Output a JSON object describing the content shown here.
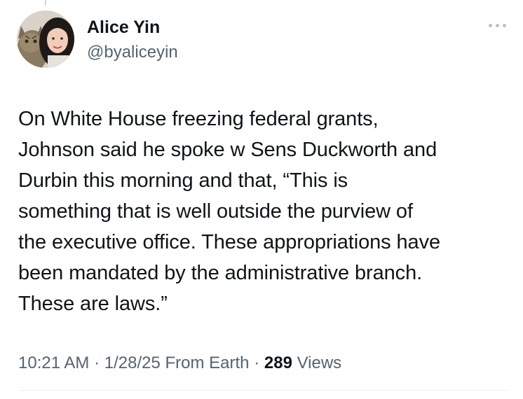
{
  "author": {
    "name": "Alice Yin",
    "handle": "@byaliceyin"
  },
  "tweet": {
    "text": "On White House freezing federal grants,\nJohnson said he spoke w Sens Duckworth and\nDurbin this morning and that, “This is\nsomething that is well outside the purview of\nthe executive office. These appropriations have\nbeen mandated by the administrative branch.\nThese are laws.”"
  },
  "meta": {
    "time": "10:21 AM",
    "separator": "·",
    "date": "1/28/25",
    "source": "From Earth",
    "views_count": "289",
    "views_label": "Views"
  },
  "icons": {
    "more": "more-horizontal-icon"
  },
  "colors": {
    "text_primary": "#0f1419",
    "text_secondary": "#536471",
    "divider": "#eff3f4"
  }
}
